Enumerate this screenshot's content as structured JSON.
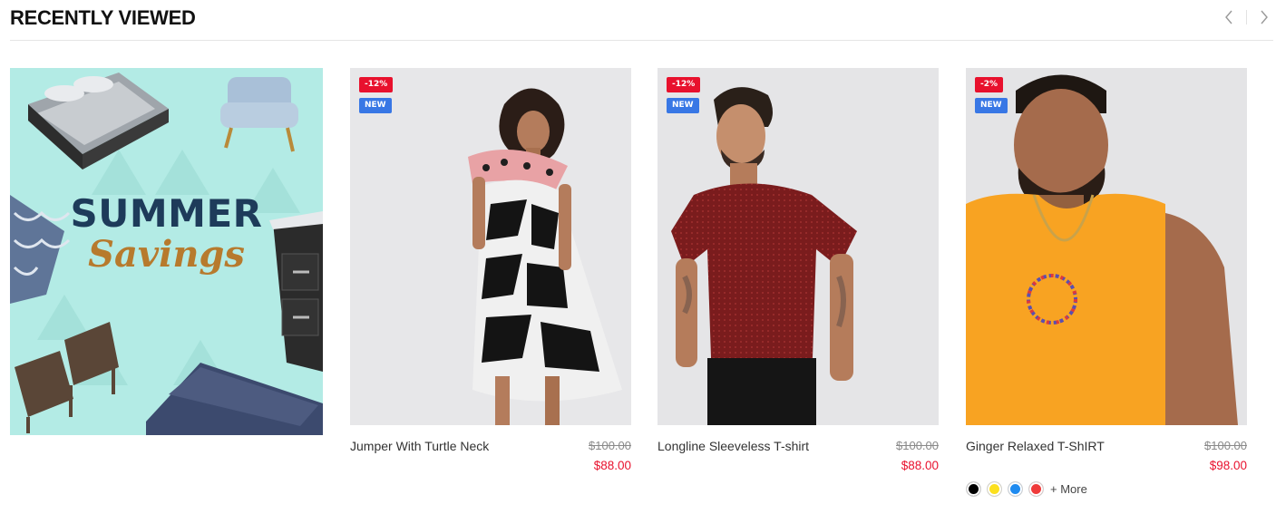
{
  "section": {
    "title": "RECENTLY VIEWED",
    "prev_icon": "chevron-left-icon",
    "next_icon": "chevron-right-icon"
  },
  "banner": {
    "title": "SUMMER",
    "subtitle": "Savings",
    "background_color": "#b3ebe5"
  },
  "products": [
    {
      "badge_sale": "-12%",
      "badge_new": "NEW",
      "name": "Jumper With Turtle Neck",
      "price_old": "$100.00",
      "price_new": "$88.00"
    },
    {
      "badge_sale": "-12%",
      "badge_new": "NEW",
      "name": "Longline Sleeveless T-shirt",
      "price_old": "$100.00",
      "price_new": "$88.00"
    },
    {
      "badge_sale": "-2%",
      "badge_new": "NEW",
      "name": "Ginger Relaxed T-ShIRT",
      "price_old": "$100.00",
      "price_new": "$98.00",
      "swatches": [
        "#000000",
        "#fce01e",
        "#1f8bf0",
        "#ef3a3a"
      ],
      "more_label": "+ More"
    }
  ],
  "colors": {
    "sale": "#e8112d",
    "new": "#3877e5",
    "price": "#e8112d"
  }
}
